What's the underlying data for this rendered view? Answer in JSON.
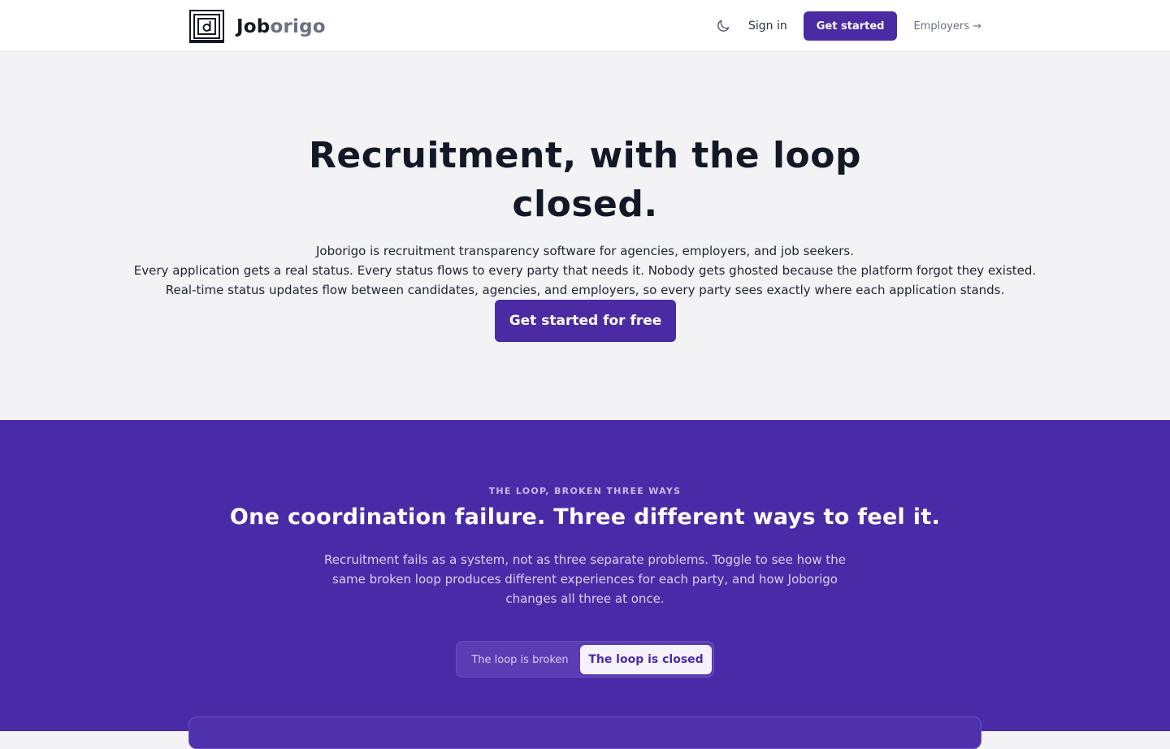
{
  "brand": {
    "name_part1": "Job",
    "name_part2": "origo"
  },
  "header": {
    "theme_icon": "moon-icon",
    "signin_label": "Sign in",
    "get_started_label": "Get started",
    "employers_label": "Employers →"
  },
  "hero": {
    "title": "Recruitment, with the loop closed.",
    "lines": [
      "Joborigo is recruitment transparency software for agencies, employers, and job seekers.",
      "Every application gets a real status. Every status flows to every party that needs it. Nobody gets ghosted because the platform forgot they existed.",
      "Real-time status updates flow between candidates, agencies, and employers, so every party sees exactly where each application stands."
    ],
    "cta_label": "Get started for free"
  },
  "loop": {
    "eyebrow": "THE LOOP, BROKEN THREE WAYS",
    "title": "One coordination failure. Three different ways to feel it.",
    "description": "Recruitment fails as a system, not as three separate problems. Toggle to see how the same broken loop produces different experiences for each party, and how Joborigo changes all three at once.",
    "toggle": {
      "options": [
        "The loop is broken",
        "The loop is closed"
      ],
      "selected": "The loop is closed"
    }
  },
  "colors": {
    "accent": "#4a2ba3",
    "section_bg": "#4a2ba7",
    "hero_bg": "#f3f3f6"
  }
}
